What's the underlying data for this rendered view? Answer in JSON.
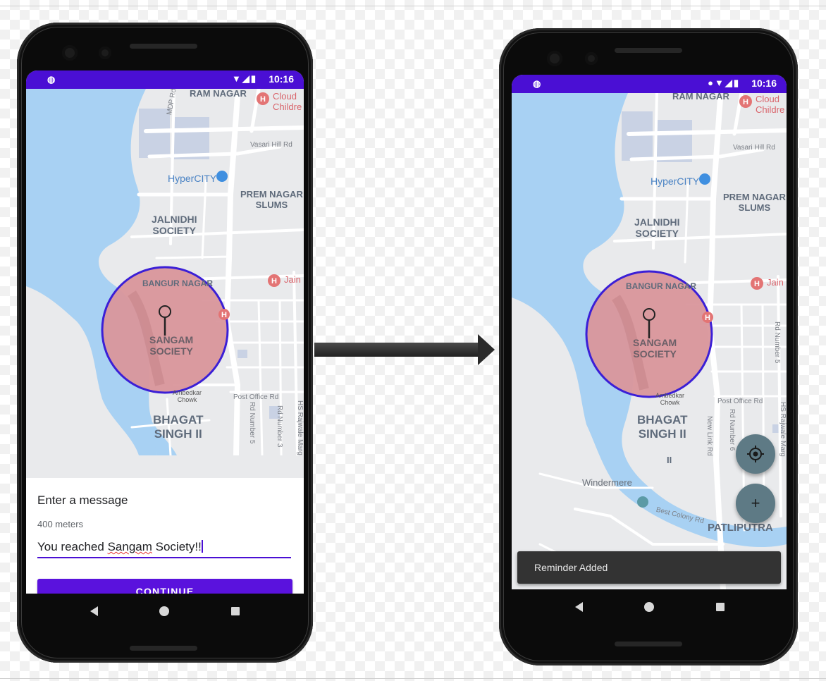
{
  "left_phone": {
    "status_time": "10:16",
    "map_labels": {
      "ram_nagar": "RAM NAGAR",
      "cloud_children": "Cloud\nChildre",
      "mdp_rd": "MDP Rd",
      "vasari_hill_rd": "Vasari Hill Rd",
      "hypercity": "HyperCITY",
      "prem_nagar": "PREM NAGAR\nSLUMS",
      "jalnidhi": "JALNIDHI\nSOCIETY",
      "jain": "Jain",
      "bangur_nagar": "BANGUR NAGAR",
      "sangam": "SANGAM\nSOCIETY",
      "ambedkar_chowk": "Ambedkar\nChowk",
      "post_office_rd": "Post Office Rd",
      "bhagat_singh": "BHAGAT\nSINGH II",
      "rd_number_5": "Rd Number 5",
      "rd_number_3": "Rd Number 3",
      "hs_rajwale": "HS Rajwale Marg"
    },
    "sheet": {
      "title": "Enter a message",
      "radius": "400 meters",
      "message_prefix": "You reached ",
      "message_misspelled": "Sangam",
      "message_suffix": " Society!!",
      "continue_label": "CONTINUE"
    }
  },
  "right_phone": {
    "status_time": "10:16",
    "map_labels": {
      "ram_nagar": "RAM NAGAR",
      "cloud_children": "Cloud\nChildre",
      "vasari_hill_rd": "Vasari Hill Rd",
      "hypercity": "HyperCITY",
      "prem_nagar": "PREM NAGAR\nSLUMS",
      "jalnidhi": "JALNIDHI\nSOCIETY",
      "jain": "Jain",
      "bangur_nagar": "BANGUR NAGAR",
      "sangam": "SANGAM\nSOCIETY",
      "ambedkar_chowk": "Ambedkar\nChowk",
      "post_office_rd": "Post Office Rd",
      "rd_number_5": "Rd Number 5",
      "bhagat_singh": "BHAGAT\nSINGH II",
      "new_link_rd": "New Link Rd",
      "rd_number_6": "Rd Number 6",
      "hs_rajwale": "HS Rajwale Marg",
      "ii": "II",
      "windermere": "Windermere",
      "best_colony_rd": "Best Colony Rd",
      "patliputra": "PATLIPUTRA"
    },
    "fab_add_label": "+",
    "snackbar_text": "Reminder Added"
  },
  "colors": {
    "status_bar": "#4a0fd4",
    "accent_button": "#5a12dd",
    "geofence_fill": "#d9969b",
    "geofence_stroke": "#3b1fd6",
    "water": "#a8d1f3",
    "land": "#e9eaec",
    "fab": "#5e7a85",
    "snackbar": "#333333"
  }
}
